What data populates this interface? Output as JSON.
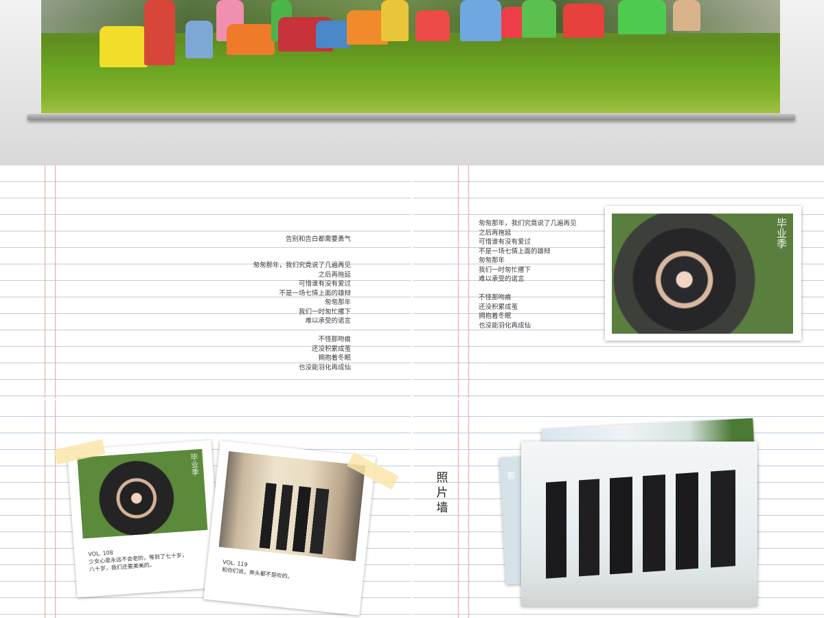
{
  "slide_a": {
    "heading": "告别和告白都需要勇气",
    "lines": [
      "匆匆那年，我们究竟说了几遍再见",
      "之后再拖延",
      "可惜谁有没有爱过",
      "不是一场七情上面的雄辩",
      "匆匆那年",
      "我们一时匆忙撂下",
      "难以承受的诺言",
      "",
      "不怪那吻痕",
      "还没积累成茧",
      "拥抱着冬眠",
      "也没能羽化再成仙"
    ]
  },
  "slide_b": {
    "lines": [
      "匆匆那年，我们究竟说了几遍再见",
      "之后再拖延",
      "可惜谁有没有爱过",
      "不是一场七情上面的雄辩",
      "匆匆那年",
      "我们一时匆忙撂下",
      "难以承受的诺言",
      "",
      "不怪那吻痕",
      "还没积累成茧",
      "拥抱着冬眠",
      "也没能羽化再成仙"
    ],
    "photo_mark": "毕业季"
  },
  "slide_c": {
    "card1": {
      "photo_mark": "毕业季",
      "vol": "VOL. 108",
      "text1": "少女心是永远不会老的，等到了七十岁，",
      "text2": "八十岁，我们还要美美的。"
    },
    "card2": {
      "vol": "VOL. 119",
      "text1": "和你们说，奔头都不是吹的。"
    }
  },
  "slide_d": {
    "title_chars": [
      "照",
      "片",
      "墙"
    ],
    "back_photo_mark": "那"
  },
  "colors": {
    "rule_line": "#b9cde0",
    "margin_line": "#e9a3a3",
    "tape": "#fae6aa"
  }
}
